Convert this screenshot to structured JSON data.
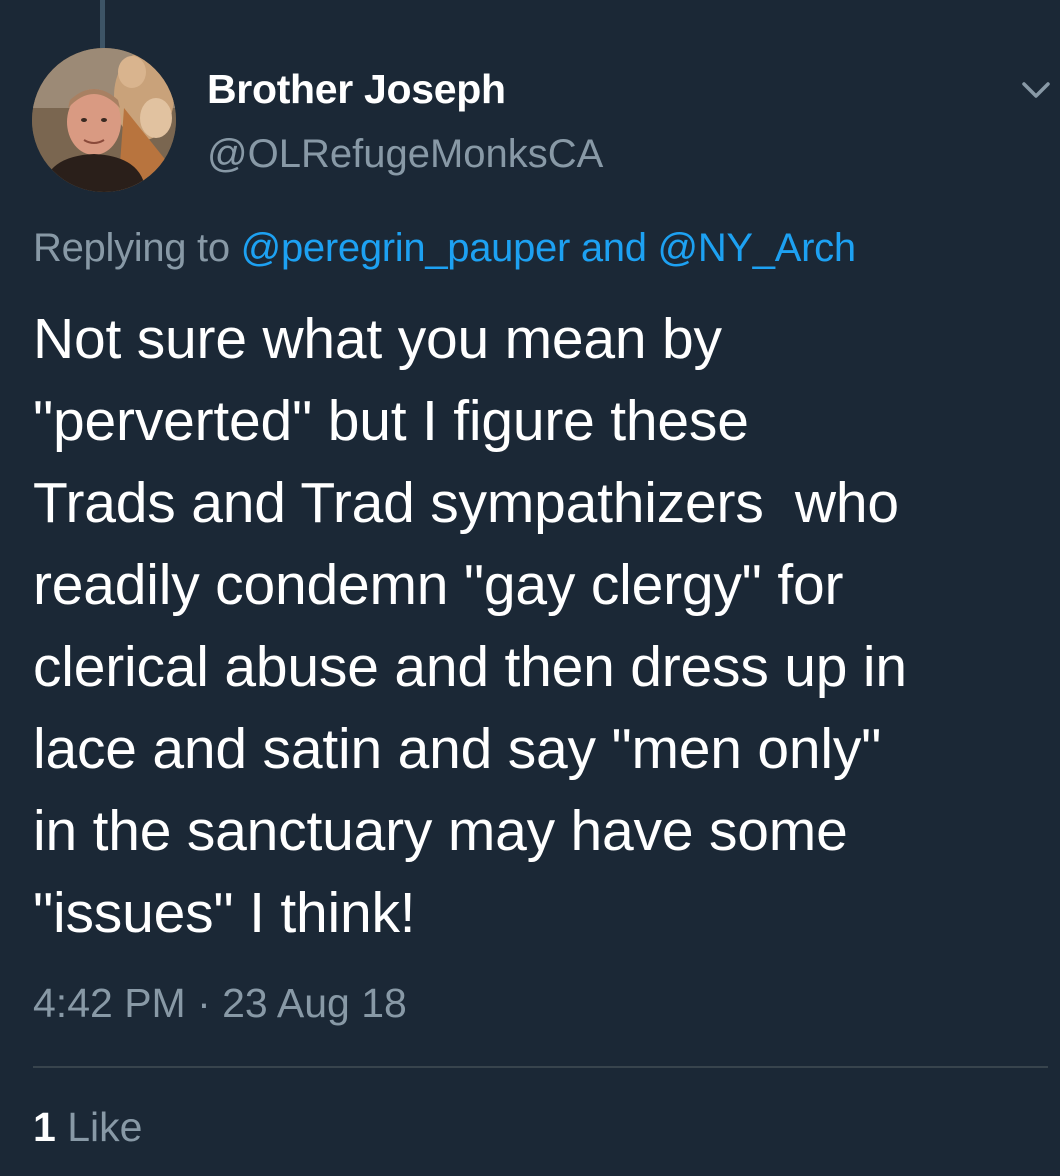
{
  "tweet": {
    "author": {
      "display_name": "Brother Joseph",
      "handle": "@OLRefugeMonksCA"
    },
    "reply_context": {
      "prefix": "Replying to",
      "mention_1": "@peregrin_pauper",
      "connector": "and",
      "mention_2": "@NY_Arch"
    },
    "text_lines": [
      "Not sure what you mean by",
      "\"perverted\" but I figure these",
      "Trads and Trad sympathizers  who",
      "readily condemn \"gay clergy\" for",
      "clerical abuse and then dress up in",
      "lace and satin and say \"men only\"",
      "in the sanctuary may have some",
      "\"issues\" I think!"
    ],
    "timestamp": "4:42 PM · 23 Aug 18",
    "likes": {
      "count": "1",
      "label": "Like"
    }
  },
  "icons": {
    "menu": "chevron-down-icon",
    "avatar": "avatar-image"
  },
  "colors": {
    "background": "#1b2836",
    "primary_text": "#ffffff",
    "secondary_text": "#8899a6",
    "link": "#1da1f2",
    "divider": "#38444d",
    "thread_line": "#3d5466"
  }
}
